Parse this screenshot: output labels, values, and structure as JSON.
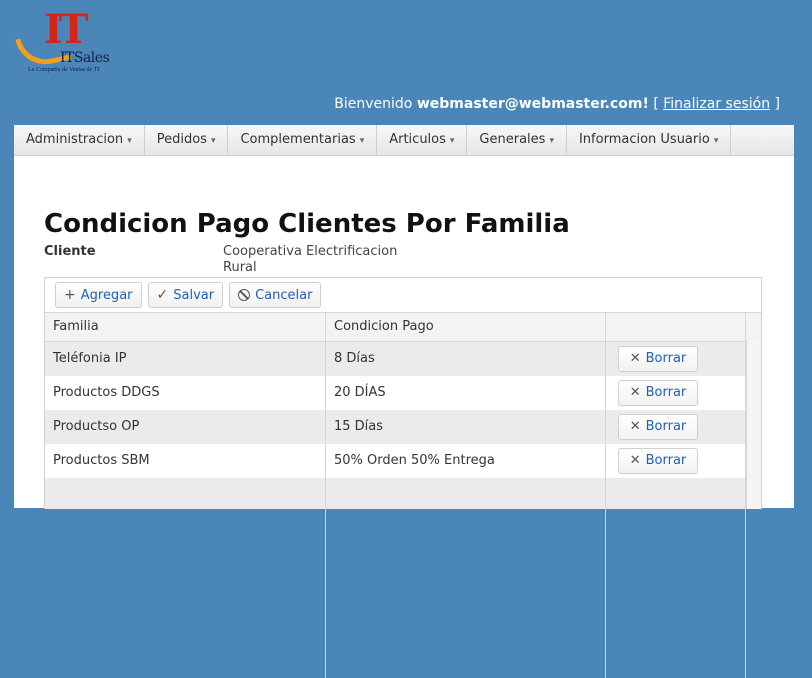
{
  "logo": {
    "mark": "IT",
    "name": "ITSales",
    "tagline": "La Compañía de Ventas de TI"
  },
  "header": {
    "welcome_prefix": "Bienvenido",
    "user": "webmaster@webmaster.com!",
    "bracket_open": "[",
    "logout_label": "Finalizar sesión",
    "bracket_close": "]"
  },
  "menu": {
    "items": [
      {
        "label": "Administracion"
      },
      {
        "label": "Pedidos"
      },
      {
        "label": "Complementarias"
      },
      {
        "label": "Articulos"
      },
      {
        "label": "Generales"
      },
      {
        "label": "Informacion Usuario"
      }
    ],
    "caret": "▾"
  },
  "page": {
    "title": "Condicion Pago Clientes Por Familia",
    "client_label": "Cliente",
    "client_value": "Cooperativa Electrificacion Rural"
  },
  "toolbar": {
    "add_label": "Agregar",
    "save_label": "Salvar",
    "cancel_label": "Cancelar"
  },
  "table": {
    "columns": [
      "Familia",
      "Condicion Pago",
      ""
    ],
    "delete_label": "Borrar",
    "rows": [
      {
        "familia": "Teléfonia IP",
        "condicion": "8 Días"
      },
      {
        "familia": "Productos DDGS",
        "condicion": "20 DÍAS"
      },
      {
        "familia": "Productso OP",
        "condicion": "15 Días"
      },
      {
        "familia": "Productos SBM",
        "condicion": "50% Orden 50% Entrega"
      }
    ]
  },
  "colors": {
    "background": "#4a86b8",
    "link": "#1f5fb4",
    "logo_red": "#d62418",
    "logo_orange": "#f0a01a"
  }
}
